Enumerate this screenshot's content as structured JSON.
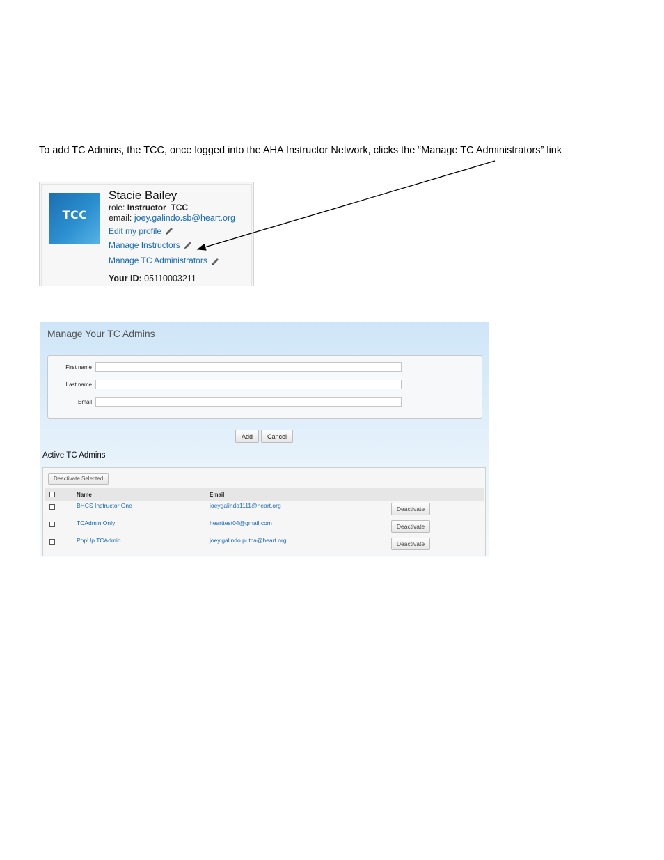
{
  "instruction": "To add TC Admins, the TCC, once logged into the AHA Instructor Network, clicks the “Manage TC Administrators” link",
  "profile": {
    "logo_text": "TCC",
    "name": "Stacie Bailey",
    "role_label": "role:",
    "role_value": "Instructor  TCC",
    "email_label": "email:",
    "email_value": "joey.galindo.sb@heart.org",
    "links": [
      {
        "label": "Edit my profile",
        "icon": "pencil-icon"
      },
      {
        "label": "Manage Instructors",
        "icon": "pencil-icon"
      },
      {
        "label": "Manage TC Administrators",
        "icon": "pencil-icon"
      }
    ],
    "id_label": "Your ID:",
    "id_value": "05110003211"
  },
  "manage": {
    "title": "Manage Your TC Admins",
    "fields": [
      {
        "label": "First name",
        "value": ""
      },
      {
        "label": "Last name",
        "value": ""
      },
      {
        "label": "Email",
        "value": ""
      }
    ],
    "add_label": "Add",
    "cancel_label": "Cancel",
    "active_title": "Active TC Admins",
    "deactivate_selected_label": "Deactivate Selected",
    "columns": [
      "Name",
      "Email"
    ],
    "rows": [
      {
        "name": "BHCS Instructor One",
        "email": "joeygalindo1111@heart.org",
        "action": "Deactivate"
      },
      {
        "name": "TCAdmin Only",
        "email": "hearttest04@gmail.com",
        "action": "Deactivate"
      },
      {
        "name": "PopUp TCAdmin",
        "email": "joey.galindo.putca@heart.org",
        "action": "Deactivate"
      }
    ]
  },
  "colors": {
    "link": "#1a6bb5",
    "panel_bg": "#cfe6f8"
  }
}
